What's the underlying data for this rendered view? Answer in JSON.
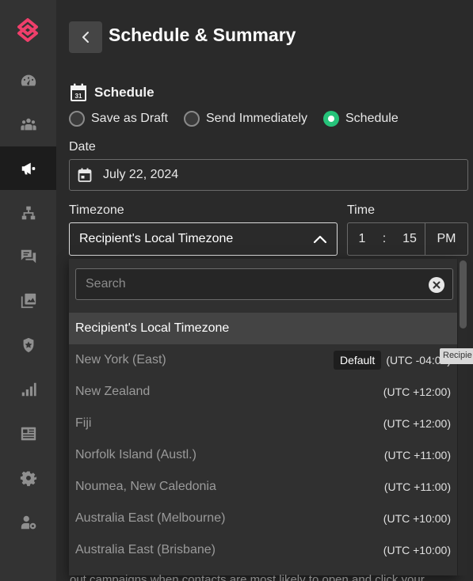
{
  "sidebar": {
    "logo_icon": "brand-logo",
    "accent_color": "#ef3f6b",
    "items": [
      {
        "icon": "dashboard-gauge-icon",
        "active": false
      },
      {
        "icon": "contacts-group-icon",
        "active": false
      },
      {
        "icon": "megaphone-icon",
        "active": true
      },
      {
        "icon": "org-chart-icon",
        "active": false
      },
      {
        "icon": "chat-bubbles-icon",
        "active": false
      },
      {
        "icon": "media-library-icon",
        "active": false
      },
      {
        "icon": "badge-star-icon",
        "active": false
      },
      {
        "icon": "bar-chart-icon",
        "active": false
      },
      {
        "icon": "newspaper-icon",
        "active": false
      },
      {
        "icon": "gear-icon",
        "active": false
      },
      {
        "icon": "admin-settings-icon",
        "active": false
      }
    ]
  },
  "header": {
    "title": "Schedule & Summary",
    "back_icon": "chevron-left-icon"
  },
  "schedule": {
    "section_title": "Schedule",
    "calendar_day": "31",
    "options": [
      {
        "label": "Save as Draft",
        "selected": false
      },
      {
        "label": "Send Immediately",
        "selected": false
      },
      {
        "label": "Schedule",
        "selected": true
      }
    ],
    "selected_color": "#26c37a",
    "date_label": "Date",
    "date_value": "July 22, 2024",
    "timezone_label": "Timezone",
    "timezone_value": "Recipient's Local Timezone",
    "time_label": "Time",
    "time_hour": "1",
    "time_sep": ":",
    "time_minute": "15",
    "time_ampm": "PM"
  },
  "timezone_dropdown": {
    "search_placeholder": "Search",
    "default_badge": "Default",
    "items": [
      {
        "name": "Recipient's Local Timezone",
        "offset": "",
        "highlight": true
      },
      {
        "name": "New York (East)",
        "offset": "(UTC -04:00)",
        "default": true
      },
      {
        "name": "New Zealand",
        "offset": "(UTC +12:00)"
      },
      {
        "name": "Fiji",
        "offset": "(UTC +12:00)"
      },
      {
        "name": "Norfolk Island (Austl.)",
        "offset": "(UTC +11:00)"
      },
      {
        "name": "Noumea, New Caledonia",
        "offset": "(UTC +11:00)"
      },
      {
        "name": "Australia East (Melbourne)",
        "offset": "(UTC +10:00)"
      },
      {
        "name": "Australia East (Brisbane)",
        "offset": "(UTC +10:00)"
      }
    ]
  },
  "tooltip": {
    "text": "Recipie"
  },
  "footer_text": "out campaigns when contacts are most likely to open and click your"
}
